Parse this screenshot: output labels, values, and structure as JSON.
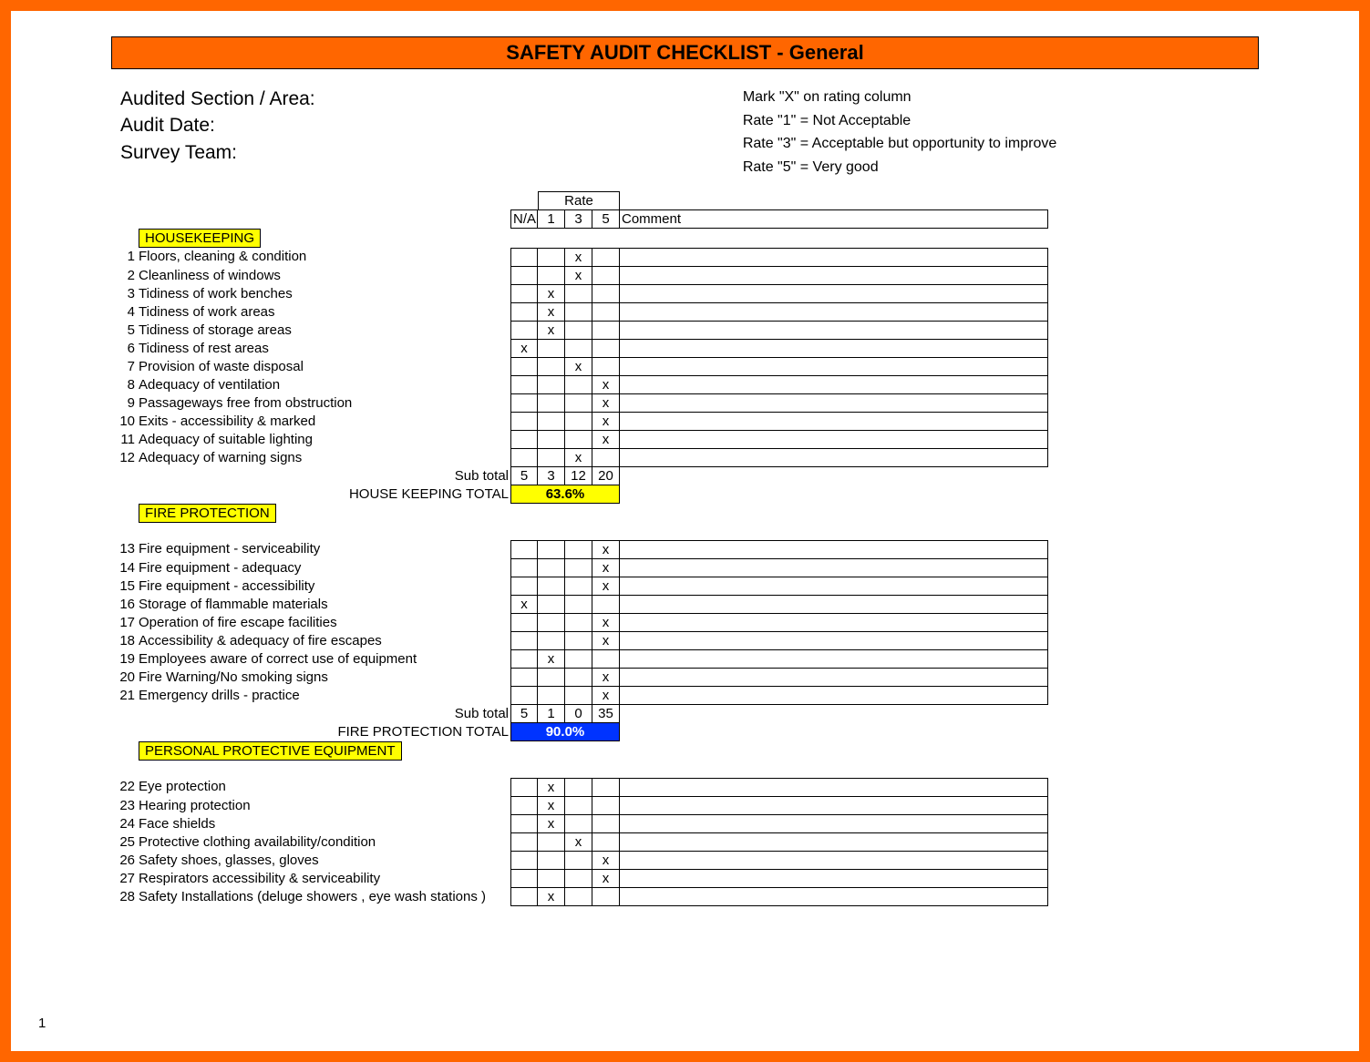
{
  "title": "SAFETY AUDIT CHECKLIST - General",
  "topLeft": {
    "l1": "Audited Section / Area:",
    "l2": "Audit Date:",
    "l3": "Survey Team:"
  },
  "topRight": {
    "l1": "Mark \"X\" on rating column",
    "l2": "Rate \"1\" = Not Acceptable",
    "l3": "Rate \"3\" = Acceptable but opportunity to improve",
    "l4": "Rate \"5\" = Very good"
  },
  "headers": {
    "rate": "Rate",
    "na": "N/A",
    "c1": "1",
    "c3": "3",
    "c5": "5",
    "comment": "Comment"
  },
  "sections": [
    {
      "name": "HOUSEKEEPING",
      "items": [
        {
          "n": "1",
          "label": "Floors, cleaning & condition",
          "na": "",
          "r1": "",
          "r3": "x",
          "r5": ""
        },
        {
          "n": "2",
          "label": "Cleanliness of windows",
          "na": "",
          "r1": "",
          "r3": "x",
          "r5": ""
        },
        {
          "n": "3",
          "label": "Tidiness of work benches",
          "na": "",
          "r1": "x",
          "r3": "",
          "r5": ""
        },
        {
          "n": "4",
          "label": "Tidiness of work areas",
          "na": "",
          "r1": "x",
          "r3": "",
          "r5": ""
        },
        {
          "n": "5",
          "label": "Tidiness of storage areas",
          "na": "",
          "r1": "x",
          "r3": "",
          "r5": ""
        },
        {
          "n": "6",
          "label": "Tidiness of rest areas",
          "na": "x",
          "r1": "",
          "r3": "",
          "r5": ""
        },
        {
          "n": "7",
          "label": "Provision of waste disposal",
          "na": "",
          "r1": "",
          "r3": "x",
          "r5": ""
        },
        {
          "n": "8",
          "label": "Adequacy of ventilation",
          "na": "",
          "r1": "",
          "r3": "",
          "r5": "x"
        },
        {
          "n": "9",
          "label": "Passageways free from obstruction",
          "na": "",
          "r1": "",
          "r3": "",
          "r5": "x"
        },
        {
          "n": "10",
          "label": "Exits - accessibility & marked",
          "na": "",
          "r1": "",
          "r3": "",
          "r5": "x"
        },
        {
          "n": "11",
          "label": "Adequacy of suitable lighting",
          "na": "",
          "r1": "",
          "r3": "",
          "r5": "x"
        },
        {
          "n": "12",
          "label": "Adequacy of warning signs",
          "na": "",
          "r1": "",
          "r3": "x",
          "r5": ""
        }
      ],
      "subLabel": "Sub total",
      "sub": {
        "na": "5",
        "r1": "3",
        "r3": "12",
        "r5": "20"
      },
      "totalLabel": "HOUSE KEEPING TOTAL",
      "totalValue": "63.6%",
      "totalStyle": "yellow"
    },
    {
      "name": "FIRE PROTECTION",
      "items": [
        {
          "n": "13",
          "label": "Fire equipment - serviceability",
          "na": "",
          "r1": "",
          "r3": "",
          "r5": "x"
        },
        {
          "n": "14",
          "label": "Fire equipment - adequacy",
          "na": "",
          "r1": "",
          "r3": "",
          "r5": "x"
        },
        {
          "n": "15",
          "label": "Fire equipment - accessibility",
          "na": "",
          "r1": "",
          "r3": "",
          "r5": "x"
        },
        {
          "n": "16",
          "label": "Storage of flammable materials",
          "na": "x",
          "r1": "",
          "r3": "",
          "r5": ""
        },
        {
          "n": "17",
          "label": "Operation of fire escape facilities",
          "na": "",
          "r1": "",
          "r3": "",
          "r5": "x"
        },
        {
          "n": "18",
          "label": "Accessibility & adequacy of fire escapes",
          "na": "",
          "r1": "",
          "r3": "",
          "r5": "x"
        },
        {
          "n": "19",
          "label": "Employees aware of correct use of equipment",
          "na": "",
          "r1": "x",
          "r3": "",
          "r5": ""
        },
        {
          "n": "20",
          "label": "Fire Warning/No smoking signs",
          "na": "",
          "r1": "",
          "r3": "",
          "r5": "x"
        },
        {
          "n": "21",
          "label": "Emergency drills - practice",
          "na": "",
          "r1": "",
          "r3": "",
          "r5": "x"
        }
      ],
      "subLabel": "Sub total",
      "sub": {
        "na": "5",
        "r1": "1",
        "r3": "0",
        "r5": "35"
      },
      "totalLabel": "FIRE PROTECTION TOTAL",
      "totalValue": "90.0%",
      "totalStyle": "blue"
    },
    {
      "name": "PERSONAL PROTECTIVE EQUIPMENT",
      "items": [
        {
          "n": "22",
          "label": "Eye protection",
          "na": "",
          "r1": "x",
          "r3": "",
          "r5": ""
        },
        {
          "n": "23",
          "label": "Hearing protection",
          "na": "",
          "r1": "x",
          "r3": "",
          "r5": ""
        },
        {
          "n": "24",
          "label": "Face shields",
          "na": "",
          "r1": "x",
          "r3": "",
          "r5": ""
        },
        {
          "n": "25",
          "label": "Protective clothing availability/condition",
          "na": "",
          "r1": "",
          "r3": "x",
          "r5": ""
        },
        {
          "n": "26",
          "label": "Safety shoes, glasses, gloves",
          "na": "",
          "r1": "",
          "r3": "",
          "r5": "x"
        },
        {
          "n": "27",
          "label": "Respirators accessibility & serviceability",
          "na": "",
          "r1": "",
          "r3": "",
          "r5": "x"
        },
        {
          "n": "28",
          "label": "Safety Installations (deluge showers , eye wash stations )",
          "na": "",
          "r1": "x",
          "r3": "",
          "r5": ""
        }
      ]
    }
  ],
  "pageNumber": "1"
}
